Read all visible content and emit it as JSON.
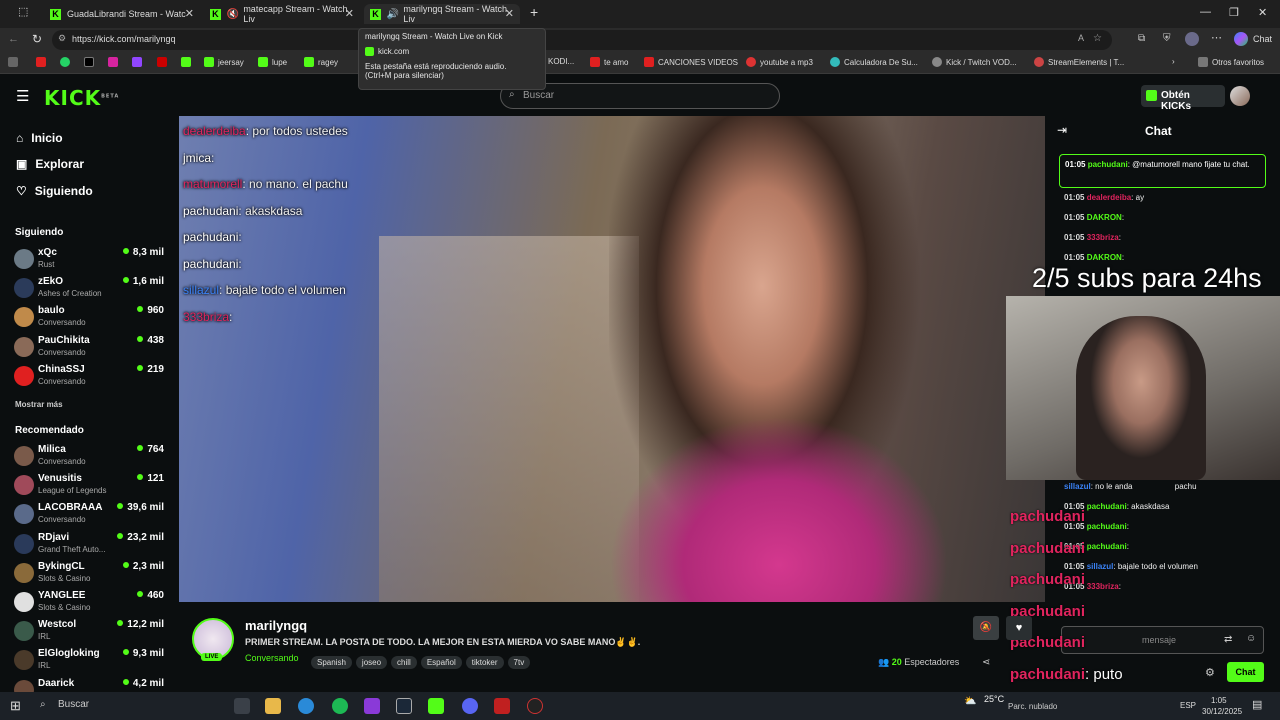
{
  "browser": {
    "tabs": [
      {
        "title": "GuadaLibrandi Stream - Watc"
      },
      {
        "title": "matecapp Stream - Watch Liv"
      },
      {
        "title": "marilyngq Stream - Watch Liv"
      }
    ],
    "url": "https://kick.com/marilyngq",
    "tooltip": {
      "title": "marilyngq Stream - Watch Live on Kick",
      "site": "kick.com",
      "audio_line1": "Esta pestaña está reproduciendo audio.",
      "audio_line2": "(Ctrl+M para silenciar)"
    },
    "bookmarks": [
      {
        "label": "jeersay"
      },
      {
        "label": "lupe"
      },
      {
        "label": "ragey"
      },
      {
        "label": "KODI..."
      },
      {
        "label": "te amo"
      },
      {
        "label": "CANCIONES VIDEOS"
      },
      {
        "label": "youtube a mp3"
      },
      {
        "label": "Calculadora De Su..."
      },
      {
        "label": "Kick / Twitch VOD..."
      },
      {
        "label": "StreamElements | T..."
      },
      {
        "label": "Otros favoritos"
      }
    ],
    "chat_label": "Chat"
  },
  "kick": {
    "logo": "KICK",
    "logo_beta": "BETA",
    "search_placeholder": "Buscar",
    "get_kicks": "Obtén KICKs"
  },
  "sidebar": {
    "nav": [
      {
        "label": "Inicio"
      },
      {
        "label": "Explorar"
      },
      {
        "label": "Siguiendo"
      }
    ],
    "following_title": "Siguiendo",
    "following": [
      {
        "name": "xQc",
        "category": "Rust",
        "viewers": "8,3 mil",
        "color": "#6b7a86"
      },
      {
        "name": "zEkO",
        "category": "Ashes of Creation",
        "viewers": "1,6 mil",
        "color": "#2b3b5a"
      },
      {
        "name": "baulo",
        "category": "Conversando",
        "viewers": "960",
        "color": "#c08a4a"
      },
      {
        "name": "PauChikita",
        "category": "Conversando",
        "viewers": "438",
        "color": "#8a6a58"
      },
      {
        "name": "ChinaSSJ",
        "category": "Conversando",
        "viewers": "219",
        "color": "#e02020"
      }
    ],
    "show_more": "Mostrar más",
    "recommended_title": "Recomendado",
    "recommended": [
      {
        "name": "Milica",
        "category": "Conversando",
        "viewers": "764",
        "color": "#7a5a4a"
      },
      {
        "name": "Venusitis",
        "category": "League of Legends",
        "viewers": "121",
        "color": "#a04a5a"
      },
      {
        "name": "LACOBRAAA",
        "category": "Conversando",
        "viewers": "39,6 mil",
        "color": "#5a6a8a"
      },
      {
        "name": "RDjavi",
        "category": "Grand Theft Auto...",
        "viewers": "23,2 mil",
        "color": "#2a3a5a"
      },
      {
        "name": "BykingCL",
        "category": "Slots & Casino",
        "viewers": "2,3 mil",
        "color": "#8a6a3a"
      },
      {
        "name": "YANGLEE",
        "category": "Slots & Casino",
        "viewers": "460",
        "color": "#e0e0e0"
      },
      {
        "name": "Westcol",
        "category": "IRL",
        "viewers": "12,2 mil",
        "color": "#3a5a4a"
      },
      {
        "name": "ElGlogloking",
        "category": "IRL",
        "viewers": "9,3 mil",
        "color": "#4a3a2a"
      },
      {
        "name": "Daarick",
        "category": "",
        "viewers": "4,2 mil",
        "color": "#6a4a3a"
      }
    ]
  },
  "video_chat": [
    {
      "user": "dealerdeiba",
      "text": "por todos ustedes",
      "color": "#e0245e"
    },
    {
      "user": "jmica",
      "text": "",
      "color": "#ffffff"
    },
    {
      "user": "matumorell",
      "text": "no mano. el pachu",
      "color": "#e0245e"
    },
    {
      "user": "pachudani",
      "text": "akaskdasa",
      "color": "#ffffff"
    },
    {
      "user": "pachudani",
      "text": "",
      "color": "#ffffff"
    },
    {
      "user": "pachudani",
      "text": "",
      "color": "#ffffff"
    },
    {
      "user": "sillazul",
      "text": "bajale todo el volumen",
      "color": "#3b82f6"
    },
    {
      "user": "333briza",
      "text": "",
      "color": "#e0245e"
    }
  ],
  "overlay": {
    "subs_goal": "2/5 subs para 24hs"
  },
  "chat": {
    "title": "Chat",
    "pinned": {
      "time": "01:05",
      "user": "pachudani",
      "text": "@matumorell mano fijate tu chat."
    },
    "messages": [
      {
        "time": "01:05",
        "user": "dealerdeiba",
        "text": "ay",
        "color": "#e0245e"
      },
      {
        "time": "01:05",
        "user": "DAKRON",
        "text": "",
        "color": "#53fc18"
      },
      {
        "time": "01:05",
        "user": "333briza",
        "text": "",
        "color": "#e0245e"
      },
      {
        "time": "01:05",
        "user": "DAKRON",
        "text": "",
        "color": "#53fc18"
      }
    ],
    "lower_messages": [
      {
        "time": "",
        "user": "sillazul",
        "text": "no le anda",
        "color": "#3b82f6",
        "suffix": "pachu"
      },
      {
        "time": "01:05",
        "user": "pachudani",
        "text": "akaskdasa",
        "color": "#53fc18"
      },
      {
        "time": "01:05",
        "user": "pachudani",
        "text": "",
        "color": "#53fc18"
      },
      {
        "time": "01:05",
        "user": "pachudani",
        "text": "",
        "color": "#53fc18"
      },
      {
        "time": "01:05",
        "user": "sillazul",
        "text": "bajale todo el volumen",
        "color": "#3b82f6"
      },
      {
        "time": "01:05",
        "user": "333briza",
        "text": "",
        "color": "#e0245e"
      }
    ],
    "big_overlay": [
      {
        "user": "pachudani"
      },
      {
        "user": "pachudani"
      },
      {
        "user": "pachudani"
      },
      {
        "user": "pachudani"
      },
      {
        "user": "pachudani"
      },
      {
        "user": "pachudani",
        "text": "puto"
      }
    ],
    "input_placeholder": "mensaje",
    "send_label": "Chat"
  },
  "stream": {
    "channel": "marilyngq",
    "title": "PRIMER STREAM. LA POSTA DE TODO. LA MEJOR EN ESTA MIERDA VO SABE MANO✌️✌️.",
    "live_badge": "LIVE",
    "category": "Conversando",
    "tags": [
      "Spanish",
      "joseo",
      "chill",
      "Español",
      "tiktoker",
      "7tv"
    ],
    "viewers": "20",
    "viewers_label": "Espectadores"
  },
  "taskbar": {
    "search_placeholder": "Buscar",
    "weather": "25°C",
    "weather_desc": "Parc. nublado",
    "lang": "ESP",
    "time": "1:05",
    "date": "30/12/2025"
  },
  "colors": {
    "kick_green": "#53fc18",
    "background": "#0b0e0f"
  }
}
